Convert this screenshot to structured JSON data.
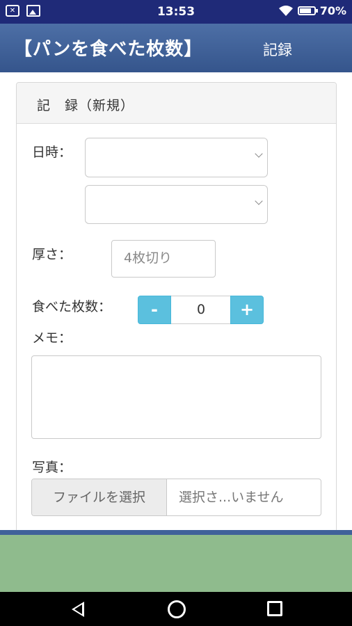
{
  "status_bar": {
    "time": "13:53",
    "battery": "70%",
    "left_icons": [
      "notification-icon",
      "image-icon"
    ],
    "right_icons": [
      "wifi-icon",
      "battery-icon"
    ]
  },
  "app_bar": {
    "title": "【パンを食べた枚数】",
    "action_label": "記録"
  },
  "panel": {
    "title": "記　録（新規）"
  },
  "form": {
    "datetime_label": "日時：",
    "date_select_value": "",
    "time_select_value": "",
    "thickness_label": "厚さ：",
    "thickness_value": "4枚切り",
    "count_label": "食べた枚数：",
    "minus_label": "-",
    "count_value": "0",
    "plus_label": "+",
    "memo_label": "メモ：",
    "memo_value": "",
    "photo_label": "写真：",
    "file_button_label": "ファイルを選択",
    "file_status": "選択さ...いません"
  },
  "colors": {
    "status_bar": "#1f2a78",
    "app_bar": "#3f619a",
    "stepper": "#5bc0de",
    "footer": "#8fbb8d"
  },
  "nav_bar": {
    "icons": [
      "back-icon",
      "home-icon",
      "recent-apps-icon"
    ]
  }
}
